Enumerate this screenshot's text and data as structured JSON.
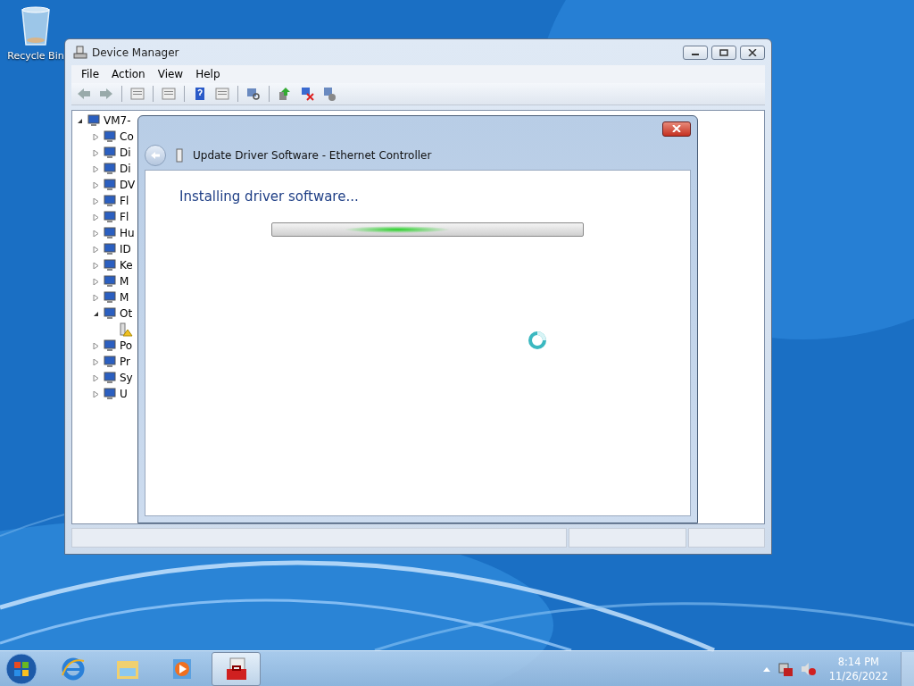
{
  "desktop": {
    "icons": [
      {
        "label": "Recycle Bin"
      }
    ]
  },
  "window": {
    "title": "Device Manager",
    "menu": [
      "File",
      "Action",
      "View",
      "Help"
    ],
    "tree": [
      {
        "label": "VM7-",
        "expanded": true,
        "children": [
          {
            "label": "Co",
            "expanded": false
          },
          {
            "label": "Di",
            "expanded": false
          },
          {
            "label": "Di",
            "expanded": false
          },
          {
            "label": "DV",
            "expanded": false
          },
          {
            "label": "Fl",
            "expanded": false
          },
          {
            "label": "Fl",
            "expanded": false
          },
          {
            "label": "Hu",
            "expanded": false
          },
          {
            "label": "ID",
            "expanded": false
          },
          {
            "label": "Ke",
            "expanded": false
          },
          {
            "label": "M",
            "expanded": false
          },
          {
            "label": "M",
            "expanded": false
          },
          {
            "label": "Ot",
            "expanded": true,
            "children": [
              {
                "kind": "warning"
              }
            ]
          },
          {
            "label": "Po",
            "expanded": false
          },
          {
            "label": "Pr",
            "expanded": false
          },
          {
            "label": "Sy",
            "expanded": false
          },
          {
            "label": "U",
            "expanded": false
          }
        ]
      }
    ]
  },
  "dialog": {
    "title": "Update Driver Software - Ethernet Controller",
    "heading": "Installing driver software...",
    "progress": {
      "indeterminate": true
    }
  },
  "taskbar": {
    "time": "8:14 PM",
    "date": "11/26/2022"
  }
}
